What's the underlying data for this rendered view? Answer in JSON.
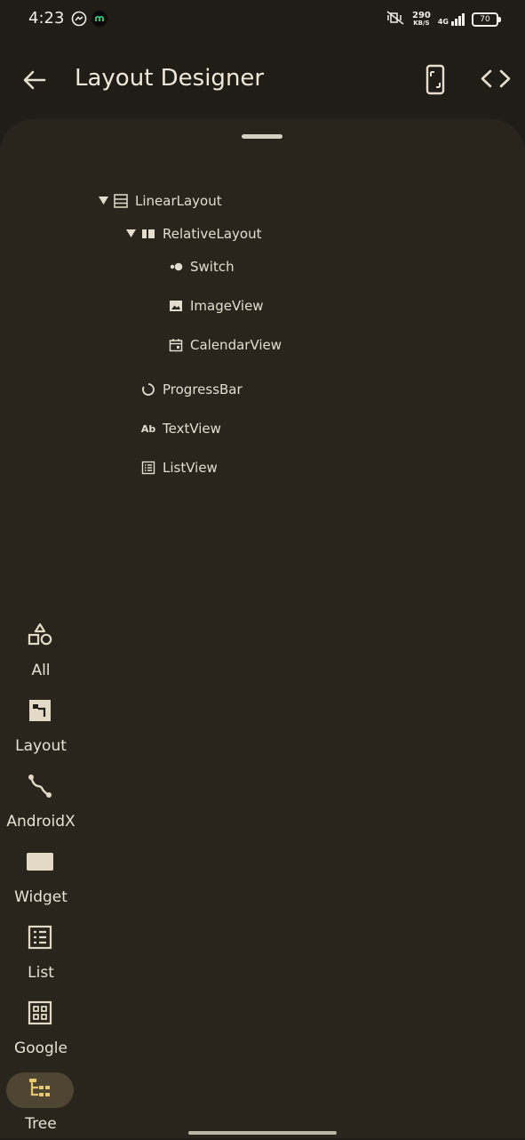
{
  "status_bar": {
    "time": "4:23",
    "speed_value": "290",
    "speed_unit": "KB/S",
    "network": "4G",
    "battery": "70"
  },
  "app_bar": {
    "title": "Layout Designer",
    "back_icon": "arrow-back-icon",
    "device_icon": "phone-device-icon",
    "code_icon": "code-icon"
  },
  "tree": [
    {
      "label": "LinearLayout",
      "icon": "linear-layout-icon",
      "expanded": true
    },
    {
      "label": "RelativeLayout",
      "icon": "relative-layout-icon",
      "expanded": true
    },
    {
      "label": "Switch",
      "icon": "switch-icon"
    },
    {
      "label": "ImageView",
      "icon": "image-icon"
    },
    {
      "label": "CalendarView",
      "icon": "calendar-icon"
    },
    {
      "label": "ProgressBar",
      "icon": "progress-icon"
    },
    {
      "label": "TextView",
      "icon": "text-icon",
      "icon_text": "Ab"
    },
    {
      "label": "ListView",
      "icon": "list-icon"
    }
  ],
  "rail": [
    {
      "label": "All",
      "icon": "shapes-icon"
    },
    {
      "label": "Layout",
      "icon": "layout-icon"
    },
    {
      "label": "AndroidX",
      "icon": "curve-icon"
    },
    {
      "label": "Widget",
      "icon": "widget-icon"
    },
    {
      "label": "List",
      "icon": "list-icon"
    },
    {
      "label": "Google",
      "icon": "grid-icon"
    },
    {
      "label": "Tree",
      "icon": "tree-icon",
      "active": true
    }
  ],
  "colors": {
    "background": "#201d17",
    "sheet": "#29251d",
    "active_indicator": "#4e4633",
    "icon": "#e2dac6"
  }
}
